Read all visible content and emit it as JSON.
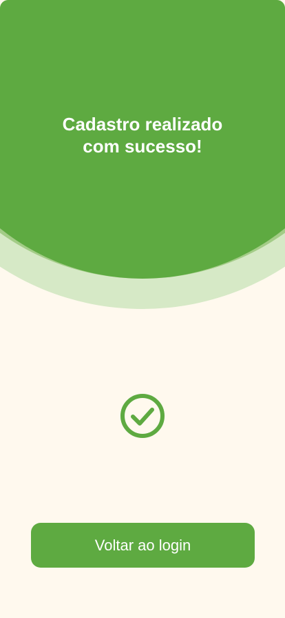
{
  "header": {
    "title_line1": "Cadastro realizado",
    "title_line2": "com sucesso!"
  },
  "status": {
    "icon": "check-circle-icon",
    "state": "success"
  },
  "actions": {
    "back_to_login_label": "Voltar ao login"
  },
  "theme": {
    "primary": "#5EAA41",
    "ring_middle": "#A3CC87",
    "ring_outer": "#D6E9C6",
    "background": "#FFF9EE",
    "text_on_primary": "#FFFFFF"
  }
}
